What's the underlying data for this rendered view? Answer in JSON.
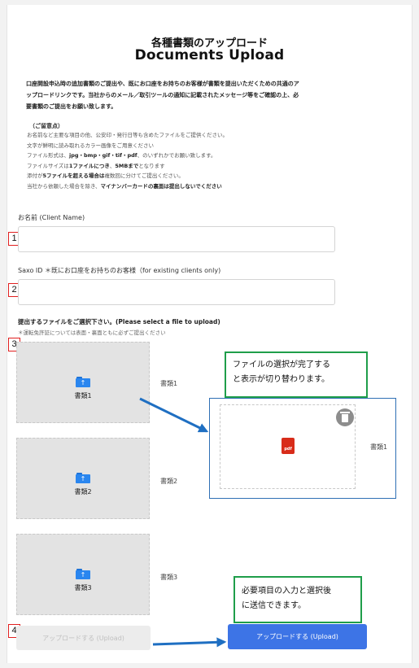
{
  "header": {
    "title_ja": "各種書類のアップロード",
    "title_en": "Documents Upload"
  },
  "intro": {
    "line1": "口座開設申込時の追加書類のご提出や、既にお口座をお持ちのお客様が書類を提出いただくための共通のア",
    "line2": "ップロードリンクです。当社からのメール／取引ツールの通知に記載されたメッセージ等をご確認の上、必",
    "line3": "要書類のご提出をお願い致します。"
  },
  "notes": {
    "title": "（ご留意点）",
    "line1": "お名前など主要な項目の他、公安印・発行日等も含めたファイルをご提供ください。",
    "line2": "文字が鮮明に読み取れるカラー画像をご用意ください",
    "line3_pre": "ファイル形式は、",
    "line3_bold": "jpg・bmp・gif・tif・pdf",
    "line3_post": "、のいずれかでお願い致します。",
    "line4_pre": "ファイルサイズは",
    "line4_bold1": "1ファイルにつき",
    "line4_mid": "、",
    "line4_bold2": "5MBまで",
    "line4_post": "となります",
    "line5_pre": "添付が",
    "line5_bold": "5ファイルを超える場合は",
    "line5_post": "複数回に分けてご提出ください。",
    "line6_pre": "当社から依頼した場合を除き、",
    "line6_bold": "マイナンバーカードの裏面は提出しないでください"
  },
  "form": {
    "name_label": "お名前 (Client Name)",
    "name_value": "",
    "saxo_label": "Saxo ID ＊既にお口座をお持ちのお客様（for existing clients only)",
    "saxo_value": "",
    "upload_title": "提出するファイルをご選択下さい。(Please select a file to upload)",
    "upload_note": "＊運転免許証については表面・裏面ともに必ずご提出ください"
  },
  "slots": [
    {
      "caption": "書類1",
      "label": "書類1"
    },
    {
      "caption": "書類2",
      "label": "書類2"
    },
    {
      "caption": "書類3",
      "label": "書類3"
    }
  ],
  "preview": {
    "pdf_text": "pdf",
    "label": "書類1"
  },
  "callouts": {
    "file_line1": "ファイルの選択が完了する",
    "file_line2": "と表示が切り替わります。",
    "submit_line1": "必要項目の入力と選択後",
    "submit_line2": "に送信できます。"
  },
  "markers": [
    "1",
    "2",
    "3",
    "4"
  ],
  "buttons": {
    "upload_disabled": "アップロードする (Upload)",
    "upload_enabled": "アップロードする (Upload)"
  },
  "colors": {
    "primary": "#3d74e6",
    "marker_red": "#e02020",
    "callout_green": "#1f9e4a",
    "arrow_blue": "#1f6fc2",
    "pdf_red": "#d82c1a",
    "folder_blue": "#2a86ef"
  },
  "icons": {
    "folder": "folder-upload-icon",
    "trash": "trash-icon",
    "pdf": "pdf-file-icon"
  }
}
